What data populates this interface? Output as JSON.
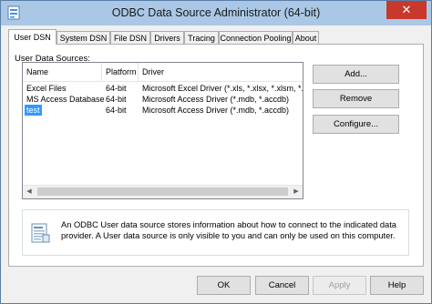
{
  "window": {
    "title": "ODBC Data Source Administrator (64-bit)",
    "close_glyph": "✕"
  },
  "tabs": [
    "User DSN",
    "System DSN",
    "File DSN",
    "Drivers",
    "Tracing",
    "Connection Pooling",
    "About"
  ],
  "user_dsn": {
    "label": "User Data Sources:",
    "columns": [
      "Name",
      "Platform",
      "Driver"
    ],
    "rows": [
      [
        "Excel Files",
        "64-bit",
        "Microsoft Excel Driver (*.xls, *.xlsx, *.xlsm, *.xlsb)"
      ],
      [
        "MS Access Database",
        "64-bit",
        "Microsoft Access Driver (*.mdb, *.accdb)"
      ],
      [
        "test",
        "64-bit",
        "Microsoft Access Driver (*.mdb, *.accdb)"
      ]
    ],
    "buttons": {
      "add": "Add...",
      "remove": "Remove",
      "configure": "Configure..."
    },
    "info": "An ODBC User data source stores information about how to connect to the indicated data provider.  A User data source is only visible to you and can only be used on this computer."
  },
  "footer": {
    "ok": "OK",
    "cancel": "Cancel",
    "apply": "Apply",
    "help": "Help"
  },
  "colors": {
    "titlebar": "#aac8e6",
    "close": "#c7392b",
    "selection": "#3399ff"
  }
}
